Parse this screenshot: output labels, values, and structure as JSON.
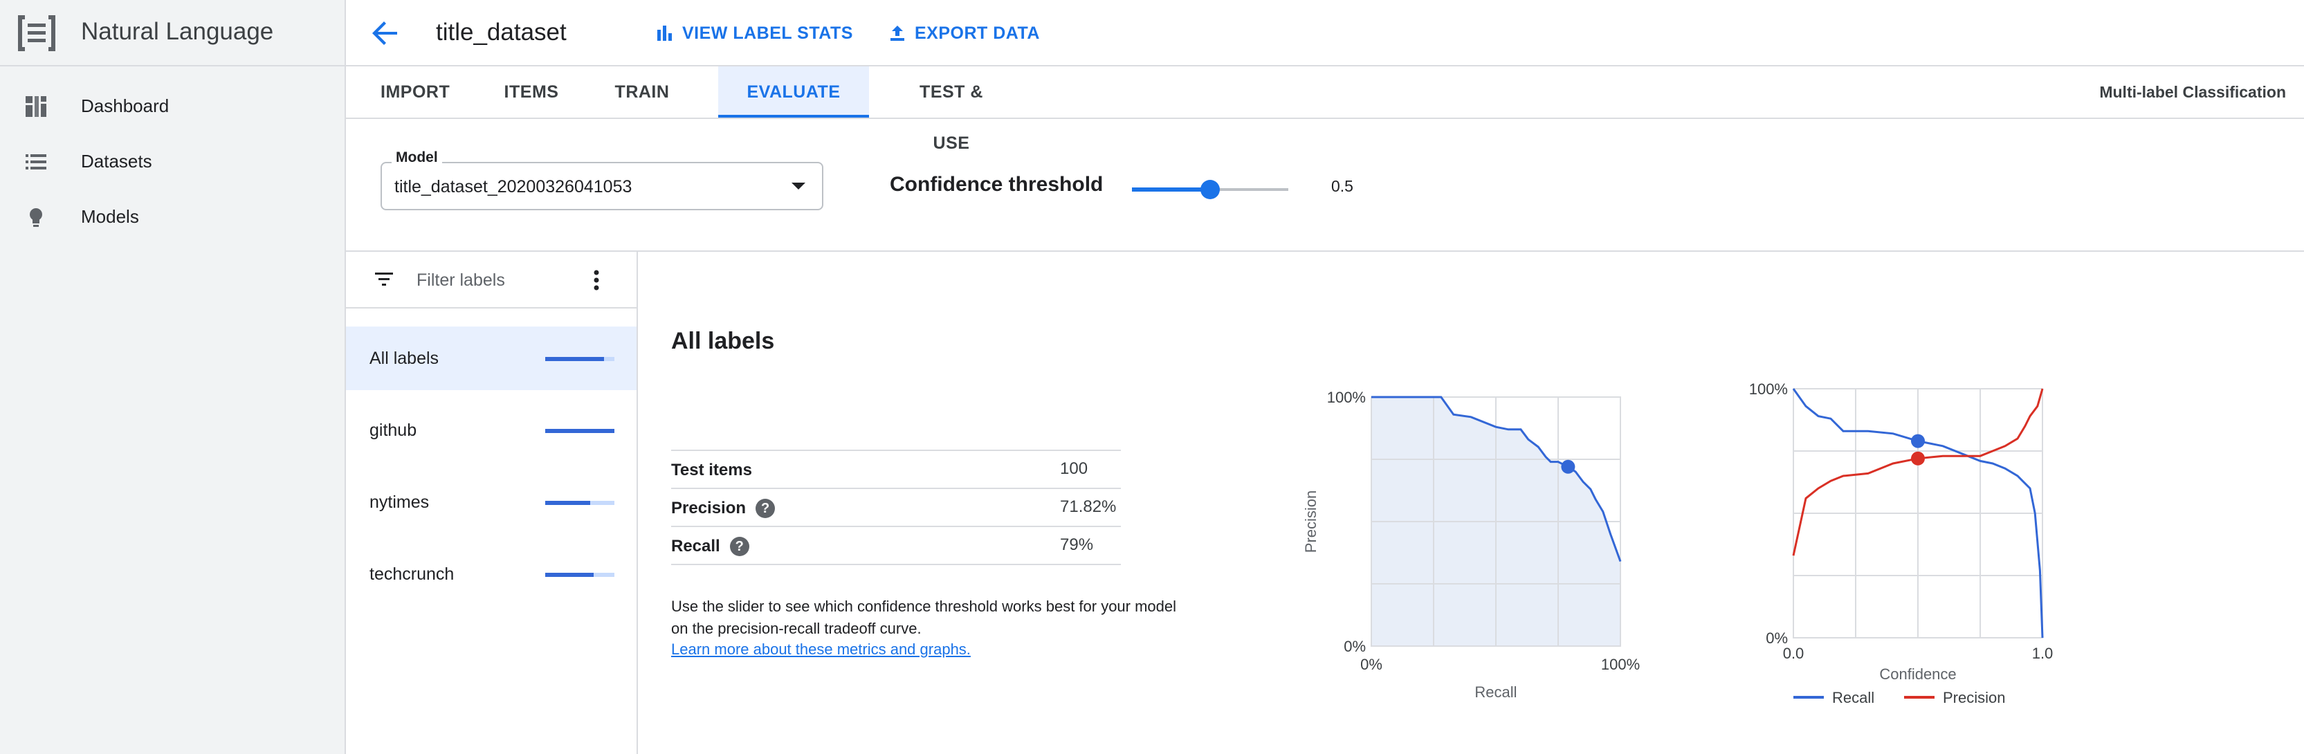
{
  "app": {
    "name": "Natural Language",
    "brand_icon": "document-bracket-icon"
  },
  "sidebar": {
    "items": [
      {
        "label": "Dashboard",
        "icon": "dashboard-icon"
      },
      {
        "label": "Datasets",
        "icon": "list-icon"
      },
      {
        "label": "Models",
        "icon": "lightbulb-icon"
      }
    ]
  },
  "header": {
    "title": "title_dataset",
    "view_label_stats": "VIEW LABEL STATS",
    "export_data": "EXPORT DATA"
  },
  "tabs": {
    "items": [
      "IMPORT",
      "ITEMS",
      "TRAIN",
      "EVALUATE",
      "TEST & USE"
    ],
    "active": "EVALUATE",
    "model_type": "Multi-label Classification"
  },
  "controls": {
    "model_legend": "Model",
    "model_value": "title_dataset_20200326041053",
    "confidence_label": "Confidence threshold",
    "confidence_value": "0.5",
    "confidence_fraction": 0.5
  },
  "labels_panel": {
    "filter_placeholder": "Filter labels",
    "items": [
      {
        "name": "All labels",
        "score": 0.85,
        "selected": true
      },
      {
        "name": "github",
        "score": 1.0,
        "selected": false
      },
      {
        "name": "nytimes",
        "score": 0.65,
        "selected": false
      },
      {
        "name": "techcrunch",
        "score": 0.7,
        "selected": false
      }
    ]
  },
  "main": {
    "title": "All labels",
    "metrics": [
      {
        "name": "Test items",
        "value": "100",
        "help": false
      },
      {
        "name": "Precision",
        "value": "71.82%",
        "help": true
      },
      {
        "name": "Recall",
        "value": "79%",
        "help": true
      }
    ],
    "help_text": "Use the slider to see which confidence threshold works best for your model on the precision-recall tradeoff curve.",
    "learn_more": "Learn more about these metrics and graphs."
  },
  "colors": {
    "accent": "#1a73e8",
    "recall_line": "#3367d6",
    "precision_line": "#d93025",
    "pr_fill": "#e8eef8"
  },
  "chart_data": [
    {
      "type": "area",
      "xlabel": "Recall",
      "ylabel": "Precision",
      "x_ticks": [
        "0%",
        "100%"
      ],
      "y_ticks": [
        "0%",
        "100%"
      ],
      "xlim": [
        0,
        1
      ],
      "ylim": [
        0,
        1
      ],
      "grid": true,
      "series": [
        {
          "x": [
            0,
            0.1,
            0.2,
            0.28,
            0.33,
            0.4,
            0.5,
            0.55,
            0.6,
            0.63,
            0.67,
            0.7,
            0.72,
            0.75,
            0.79,
            0.82,
            0.85,
            0.88,
            0.9,
            0.93,
            0.96,
            1.0
          ],
          "y": [
            1.0,
            1.0,
            1.0,
            1.0,
            0.93,
            0.92,
            0.88,
            0.87,
            0.87,
            0.83,
            0.8,
            0.76,
            0.74,
            0.74,
            0.72,
            0.7,
            0.66,
            0.63,
            0.59,
            0.54,
            0.45,
            0.34
          ]
        }
      ],
      "marker": {
        "x": 0.79,
        "y": 0.72
      }
    },
    {
      "type": "line",
      "xlabel": "Confidence",
      "x_ticks": [
        "0.0",
        "1.0"
      ],
      "y_ticks": [
        "0%",
        "100%"
      ],
      "xlim": [
        0,
        1
      ],
      "ylim": [
        0,
        1
      ],
      "grid": true,
      "legend": "bottom",
      "series": [
        {
          "name": "Recall",
          "x": [
            0,
            0.05,
            0.1,
            0.15,
            0.2,
            0.3,
            0.4,
            0.5,
            0.6,
            0.7,
            0.75,
            0.8,
            0.85,
            0.9,
            0.95,
            0.97,
            0.99,
            1.0
          ],
          "y": [
            1.0,
            0.93,
            0.89,
            0.88,
            0.83,
            0.83,
            0.82,
            0.79,
            0.77,
            0.73,
            0.71,
            0.7,
            0.68,
            0.65,
            0.6,
            0.5,
            0.27,
            0.0
          ]
        },
        {
          "name": "Precision",
          "x": [
            0,
            0.05,
            0.1,
            0.15,
            0.2,
            0.3,
            0.4,
            0.5,
            0.6,
            0.7,
            0.75,
            0.8,
            0.85,
            0.9,
            0.93,
            0.95,
            0.98,
            1.0
          ],
          "y": [
            0.33,
            0.56,
            0.6,
            0.63,
            0.65,
            0.66,
            0.7,
            0.72,
            0.73,
            0.73,
            0.73,
            0.75,
            0.77,
            0.8,
            0.85,
            0.89,
            0.93,
            1.0
          ]
        }
      ],
      "marker_x": 0.5
    }
  ]
}
